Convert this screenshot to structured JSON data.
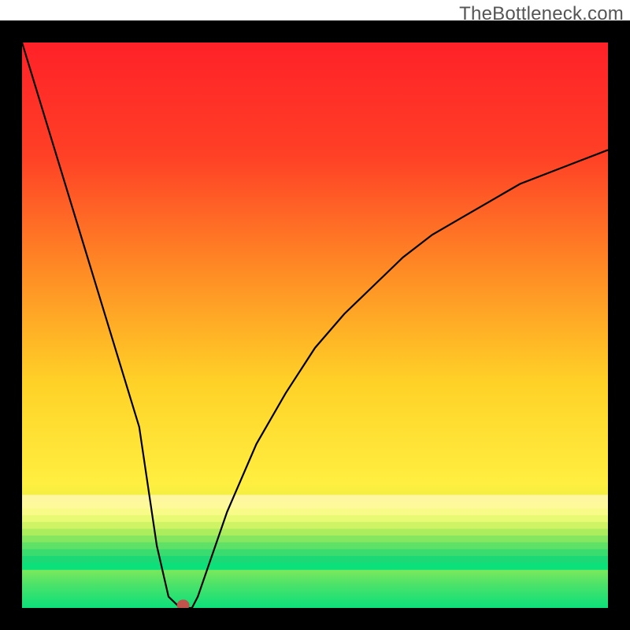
{
  "watermark": "TheBottleneck.com",
  "colors": {
    "black": "#000000",
    "top_red": "#ff2128",
    "mid_yellow": "#ffe635",
    "bottom_green": "#0ce07a",
    "marker": "#c0544d",
    "border": "#000000"
  },
  "geometry": {
    "border_thickness": 28,
    "inner_width": 744,
    "inner_height": 718
  },
  "chart_data": {
    "type": "line",
    "title": "",
    "xlabel": "",
    "ylabel": "",
    "xlim": [
      0,
      100
    ],
    "ylim": [
      0,
      100
    ],
    "x": [
      0,
      5,
      10,
      15,
      20,
      23,
      25,
      27,
      28,
      29,
      30,
      35,
      40,
      45,
      50,
      55,
      60,
      65,
      70,
      75,
      80,
      85,
      90,
      95,
      100
    ],
    "values": [
      100,
      83,
      66,
      49,
      32,
      11,
      2,
      0,
      0,
      0,
      2,
      17,
      29,
      38,
      46,
      52,
      57,
      62,
      66,
      69,
      72,
      75,
      77,
      79,
      81
    ],
    "marker": {
      "x": 27.5,
      "y": 0.5
    },
    "background_gradient": {
      "stops": [
        {
          "pos": 0.0,
          "color": "#ff2128"
        },
        {
          "pos": 0.2,
          "color": "#ff4026"
        },
        {
          "pos": 0.4,
          "color": "#ff8a25"
        },
        {
          "pos": 0.6,
          "color": "#ffd127"
        },
        {
          "pos": 0.78,
          "color": "#ffef40"
        },
        {
          "pos": 0.9,
          "color": "#b8f04a"
        },
        {
          "pos": 0.96,
          "color": "#49e26a"
        },
        {
          "pos": 1.0,
          "color": "#0ce07a"
        }
      ]
    },
    "lower_bars": {
      "start_y": 80,
      "bar_height": 1.2,
      "colors": [
        "#fff6a0",
        "#fef99a",
        "#f8fb88",
        "#e8f974",
        "#cef465",
        "#aced5e",
        "#85e660",
        "#5fe067",
        "#3bdc6f",
        "#1cd976",
        "#0ce07a"
      ]
    }
  }
}
